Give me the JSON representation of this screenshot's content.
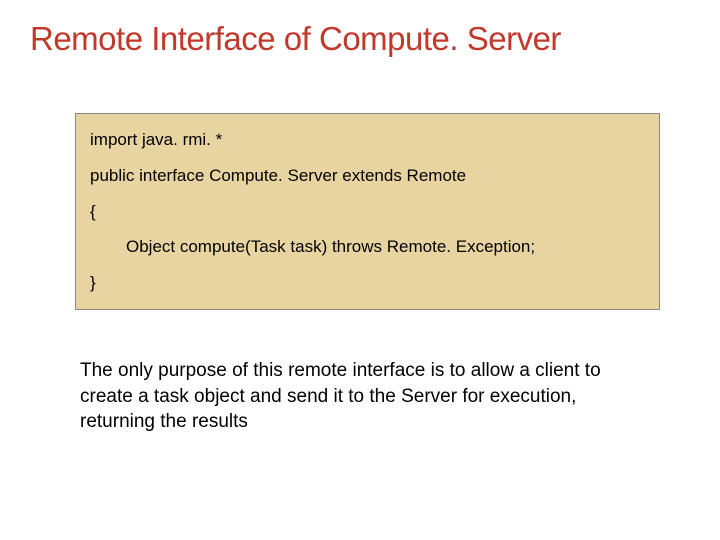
{
  "title": "Remote Interface of Compute. Server",
  "code": {
    "line1": "import java. rmi. *",
    "line2": "public interface Compute. Server extends Remote",
    "line3": "{",
    "line4": "Object compute(Task task) throws Remote. Exception;",
    "line5": "}"
  },
  "body": "The only purpose of this remote interface is to allow a client to create a task object and send it to the Server for execution, returning the results"
}
